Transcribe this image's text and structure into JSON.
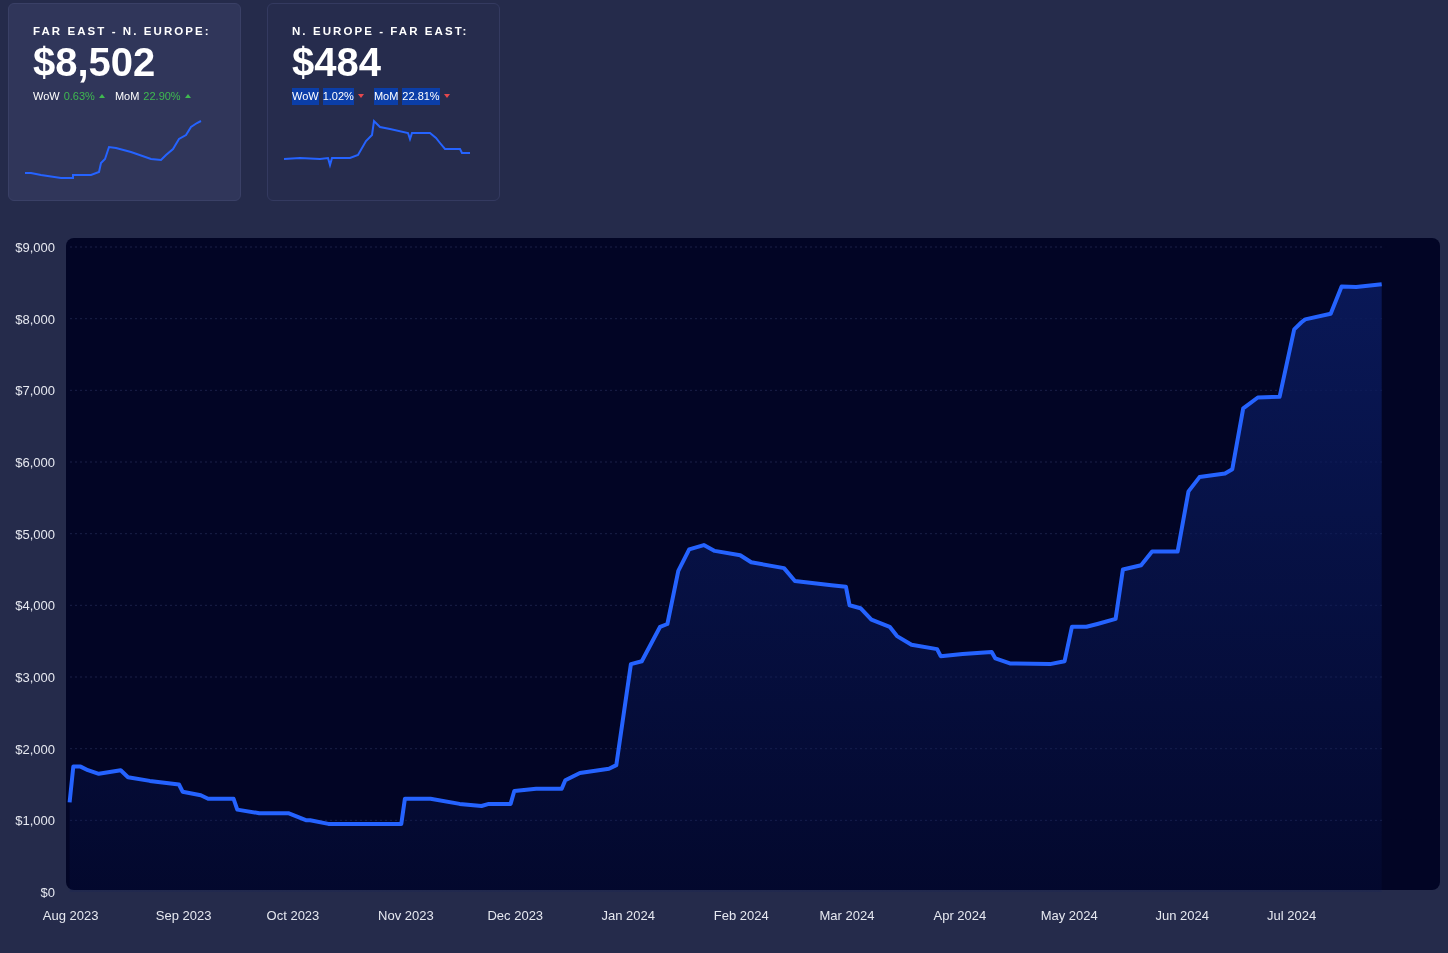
{
  "cards": [
    {
      "title": "FAR EAST - N. EUROPE:",
      "value": "$8,502",
      "hovered": true,
      "text_selected": false,
      "changes": [
        {
          "label": "WoW",
          "value": "0.63%",
          "rising": true
        },
        {
          "label": "MoM",
          "value": "22.90%",
          "rising": true
        }
      ]
    },
    {
      "title": "N. EUROPE - FAR EAST:",
      "value": "$484",
      "hovered": false,
      "text_selected": true,
      "changes": [
        {
          "label": "WoW",
          "value": "1.02%",
          "rising": false
        },
        {
          "label": "MoM",
          "value": "22.81%",
          "rising": false
        }
      ]
    }
  ],
  "chart_data": {
    "type": "area",
    "grid": true,
    "xlim": [
      "2023-07-31",
      "2024-08-11"
    ],
    "ylim": [
      0,
      9000
    ],
    "yticks": [
      {
        "value": 0,
        "label": "$0"
      },
      {
        "value": 1000,
        "label": "$1,000"
      },
      {
        "value": 2000,
        "label": "$2,000"
      },
      {
        "value": 3000,
        "label": "$3,000"
      },
      {
        "value": 4000,
        "label": "$4,000"
      },
      {
        "value": 5000,
        "label": "$5,000"
      },
      {
        "value": 6000,
        "label": "$6,000"
      },
      {
        "value": 7000,
        "label": "$7,000"
      },
      {
        "value": 8000,
        "label": "$8,000"
      },
      {
        "value": 9000,
        "label": "$9,000"
      }
    ],
    "xticks": [
      {
        "value": "2023-08-01",
        "label": "Aug 2023"
      },
      {
        "value": "2023-09-01",
        "label": "Sep 2023"
      },
      {
        "value": "2023-10-01",
        "label": "Oct 2023"
      },
      {
        "value": "2023-11-01",
        "label": "Nov 2023"
      },
      {
        "value": "2023-12-01",
        "label": "Dec 2023"
      },
      {
        "value": "2024-01-01",
        "label": "Jan 2024"
      },
      {
        "value": "2024-02-01",
        "label": "Feb 2024"
      },
      {
        "value": "2024-03-01",
        "label": "Mar 2024"
      },
      {
        "value": "2024-04-01",
        "label": "Apr 2024"
      },
      {
        "value": "2024-05-01",
        "label": "May 2024"
      },
      {
        "value": "2024-06-01",
        "label": "Jun 2024"
      },
      {
        "value": "2024-07-01",
        "label": "Jul 2024"
      }
    ],
    "x": [
      "2023-08-01",
      "2023-08-02",
      "2023-08-04",
      "2023-08-06",
      "2023-08-09",
      "2023-08-15",
      "2023-08-17",
      "2023-08-23",
      "2023-08-31",
      "2023-09-01",
      "2023-09-06",
      "2023-09-08",
      "2023-09-15",
      "2023-09-16",
      "2023-09-22",
      "2023-09-30",
      "2023-10-05",
      "2023-10-06",
      "2023-10-11",
      "2023-10-20",
      "2023-10-31",
      "2023-11-01",
      "2023-11-08",
      "2023-11-16",
      "2023-11-22",
      "2023-11-24",
      "2023-11-30",
      "2023-12-01",
      "2023-12-07",
      "2023-12-14",
      "2023-12-15",
      "2023-12-19",
      "2023-12-27",
      "2023-12-29",
      "2024-01-02",
      "2024-01-05",
      "2024-01-10",
      "2024-01-12",
      "2024-01-15",
      "2024-01-18",
      "2024-01-22",
      "2024-01-25",
      "2024-02-01",
      "2024-02-04",
      "2024-02-13",
      "2024-02-16",
      "2024-02-26",
      "2024-03-01",
      "2024-03-02",
      "2024-03-05",
      "2024-03-08",
      "2024-03-13",
      "2024-03-15",
      "2024-03-19",
      "2024-03-26",
      "2024-03-27",
      "2024-04-02",
      "2024-04-10",
      "2024-04-11",
      "2024-04-15",
      "2024-04-26",
      "2024-04-30",
      "2024-05-02",
      "2024-05-06",
      "2024-05-09",
      "2024-05-14",
      "2024-05-16",
      "2024-05-21",
      "2024-05-24",
      "2024-05-31",
      "2024-06-03",
      "2024-06-06",
      "2024-06-13",
      "2024-06-15",
      "2024-06-18",
      "2024-06-22",
      "2024-06-28",
      "2024-07-02",
      "2024-07-04",
      "2024-07-05",
      "2024-07-12",
      "2024-07-15",
      "2024-07-19",
      "2024-07-26"
    ],
    "series": [
      {
        "color": "#2563ff",
        "values": [
          1250,
          1750,
          1750,
          1700,
          1650,
          1700,
          1600,
          1550,
          1500,
          1400,
          1350,
          1300,
          1300,
          1150,
          1100,
          1100,
          1000,
          1000,
          950,
          950,
          950,
          1300,
          1300,
          1230,
          1200,
          1230,
          1230,
          1410,
          1440,
          1440,
          1560,
          1660,
          1720,
          1770,
          3180,
          3220,
          3700,
          3740,
          4480,
          4780,
          4840,
          4760,
          4700,
          4600,
          4520,
          4340,
          4280,
          4260,
          4000,
          3960,
          3800,
          3700,
          3570,
          3450,
          3390,
          3290,
          3320,
          3350,
          3260,
          3190,
          3180,
          3220,
          3700,
          3700,
          3740,
          3810,
          4500,
          4560,
          4750,
          4750,
          5590,
          5790,
          5840,
          5900,
          6750,
          6900,
          6910,
          7850,
          7950,
          7990,
          8070,
          8450,
          8440,
          8480
        ]
      }
    ]
  }
}
